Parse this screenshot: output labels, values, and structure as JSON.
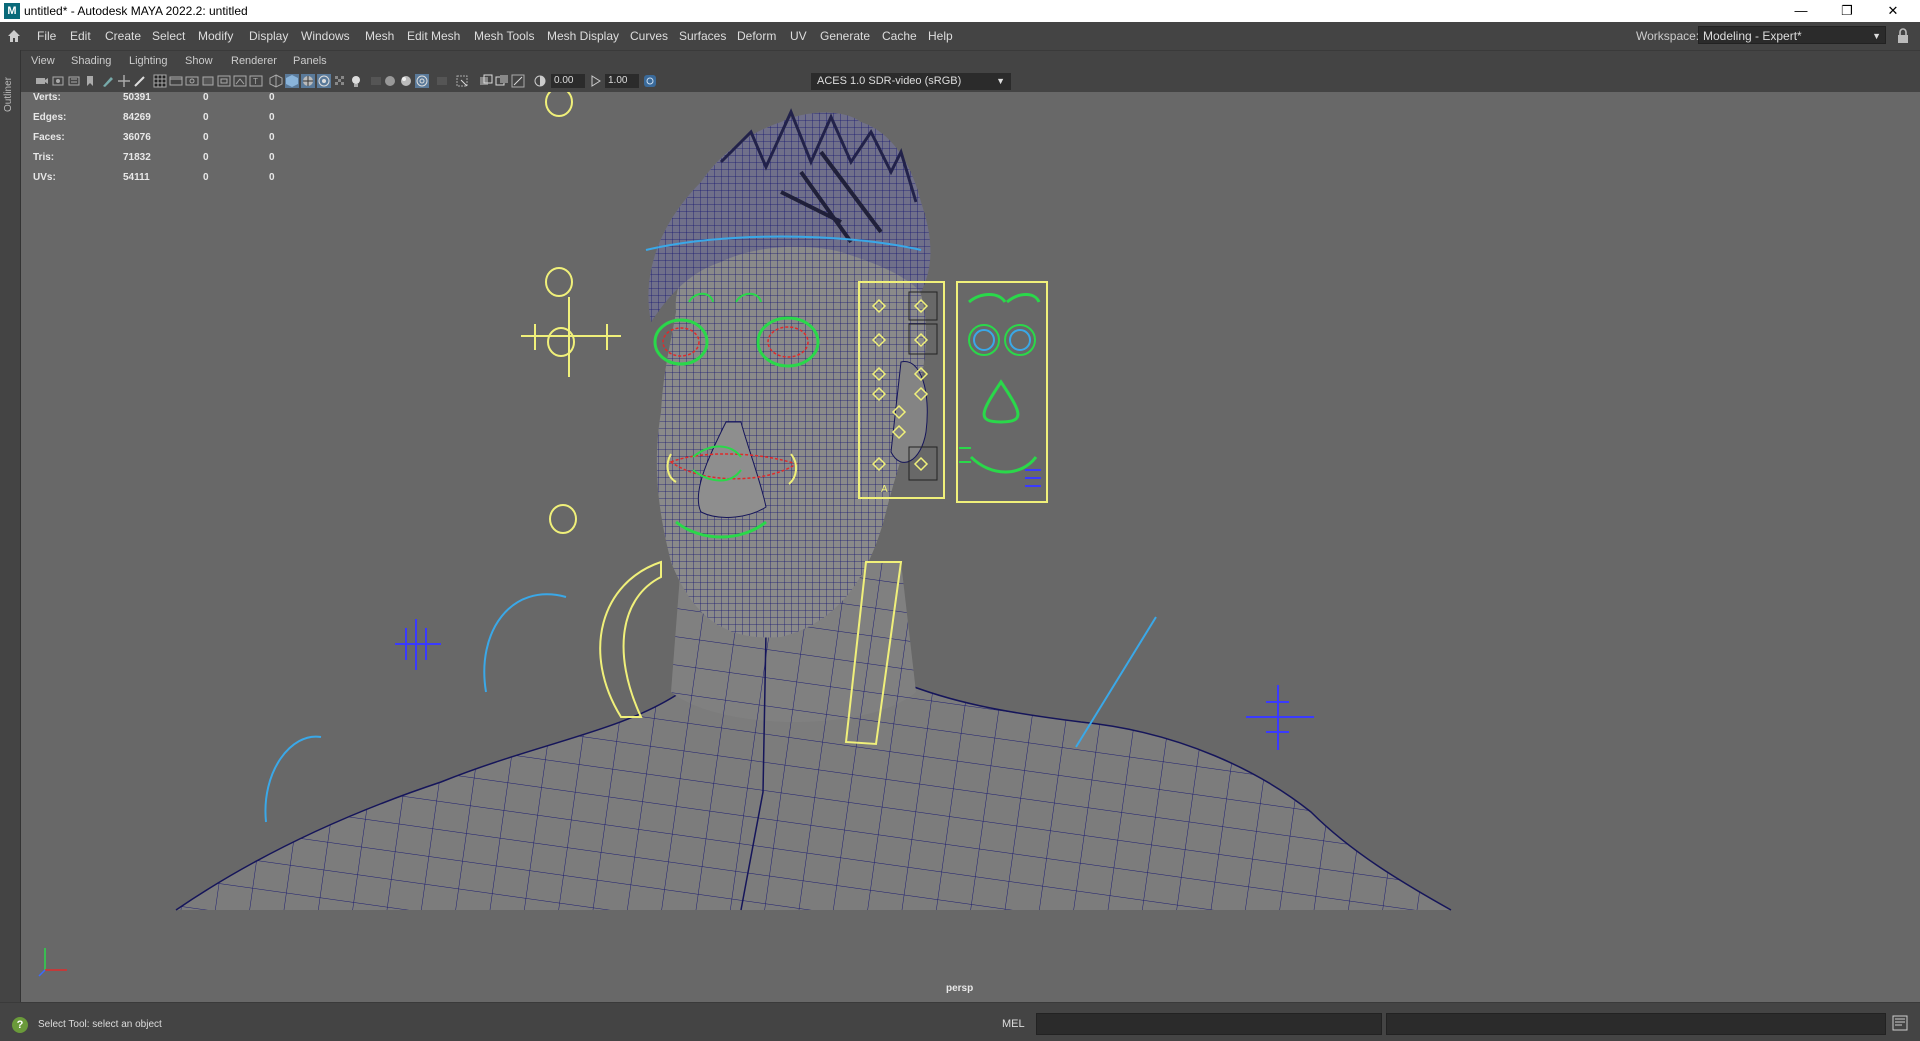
{
  "window": {
    "title": "untitled* - Autodesk MAYA 2022.2: untitled",
    "app_icon_letter": "M"
  },
  "menubar": {
    "items": [
      "File",
      "Edit",
      "Create",
      "Select",
      "Modify",
      "Display",
      "Windows",
      "Mesh",
      "Edit Mesh",
      "Mesh Tools",
      "Mesh Display",
      "Curves",
      "Surfaces",
      "Deform",
      "UV",
      "Generate",
      "Cache",
      "Help"
    ],
    "workspace_label": "Workspace:",
    "workspace_value": "Modeling - Expert*"
  },
  "outliner": {
    "label": "Outliner"
  },
  "panel_menu": {
    "items": [
      "View",
      "Shading",
      "Lighting",
      "Show",
      "Renderer",
      "Panels"
    ]
  },
  "panel_toolbar": {
    "exposure_value": "0.00",
    "gamma_value": "1.00",
    "color_space": "ACES 1.0 SDR-video (sRGB)"
  },
  "hud": {
    "rows": [
      {
        "label": "Verts:",
        "value": "50391",
        "a": "0",
        "b": "0"
      },
      {
        "label": "Edges:",
        "value": "84269",
        "a": "0",
        "b": "0"
      },
      {
        "label": "Faces:",
        "value": "36076",
        "a": "0",
        "b": "0"
      },
      {
        "label": "Tris:",
        "value": "71832",
        "a": "0",
        "b": "0"
      },
      {
        "label": "UVs:",
        "value": "54111",
        "a": "0",
        "b": "0"
      }
    ]
  },
  "viewport": {
    "camera": "persp",
    "colors": {
      "background": "#686868",
      "wire": "#1a1a7a",
      "control": "#f0f07a",
      "green": "#2ad84a",
      "cyan": "#3aa8e8"
    }
  },
  "statusbar": {
    "help_text": "Select Tool: select an object",
    "mel_label": "MEL"
  }
}
